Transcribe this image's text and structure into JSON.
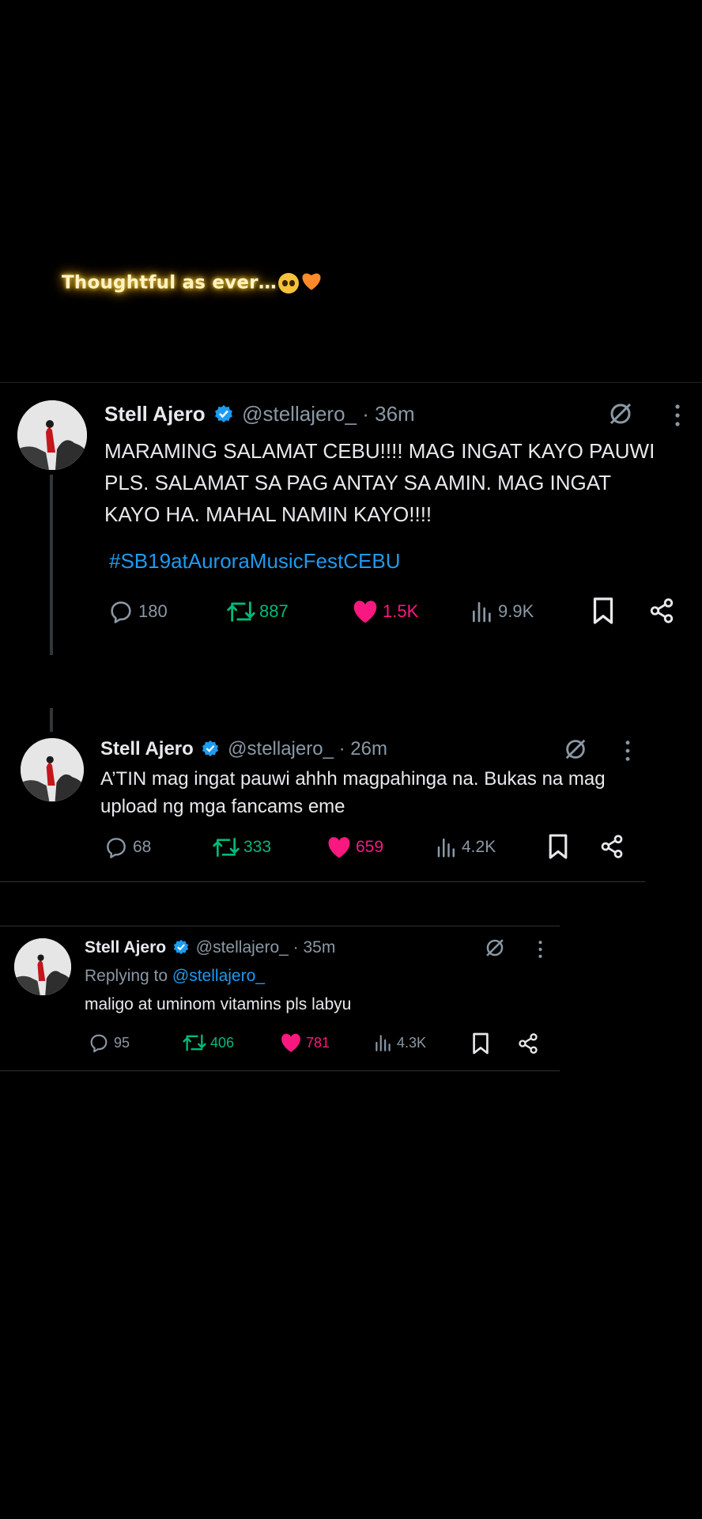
{
  "caption": {
    "text": "Thoughtful as ever…"
  },
  "colors": {
    "accent": "#1d9bf0",
    "retweet": "#00ba7c",
    "like": "#f91880",
    "muted": "#8b98a5",
    "background": "#000000"
  },
  "tweets": [
    {
      "name": "Stell Ajero",
      "handle": "@stellajero_",
      "time": "· 36m",
      "text": "MARAMING SALAMAT CEBU!!!! MAG INGAT KAYO PAUWI PLS. SALAMAT SA PAG ANTAY SA AMIN. MAG INGAT KAYO HA. MAHAL NAMIN KAYO!!!!",
      "hashtag": "#SB19atAuroraMusicFestCEBU",
      "replies": "180",
      "retweets": "887",
      "likes": "1.5K",
      "views": "9.9K"
    },
    {
      "name": "Stell Ajero",
      "handle": "@stellajero_",
      "time": "· 26m",
      "text": "A’TIN mag ingat pauwi ahhh magpahinga na. Bukas na mag upload ng mga fancams eme",
      "replies": "68",
      "retweets": "333",
      "likes": "659",
      "views": "4.2K"
    },
    {
      "name": "Stell Ajero",
      "handle": "@stellajero_",
      "time": "· 35m",
      "replying_prefix": "Replying to",
      "replying_to": "@stellajero_",
      "text": "maligo at uminom vitamins pls labyu",
      "replies": "95",
      "retweets": "406",
      "likes": "781",
      "views": "4.3K"
    }
  ]
}
